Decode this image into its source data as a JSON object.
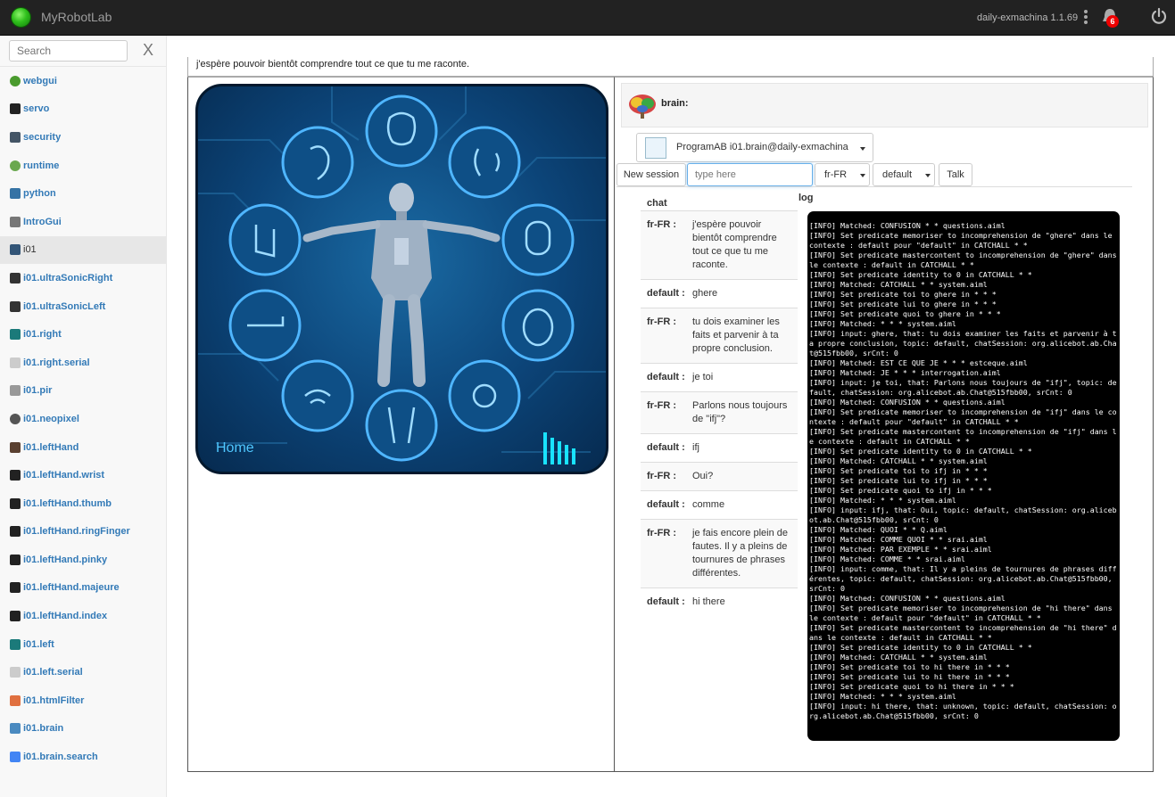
{
  "app": {
    "title": "MyRobotLab",
    "version": "daily-exmachina 1.1.69",
    "notification_count": "6"
  },
  "sidebar": {
    "search_placeholder": "Search",
    "clear_label": "X",
    "items": [
      {
        "label": "webgui",
        "icon": "globe-icon",
        "color": "#4a9b2e"
      },
      {
        "label": "servo",
        "icon": "servo-icon",
        "color": "#222222"
      },
      {
        "label": "security",
        "icon": "lock-icon",
        "color": "#445566"
      },
      {
        "label": "runtime",
        "icon": "runtime-icon",
        "color": "#6aa84f"
      },
      {
        "label": "python",
        "icon": "python-icon",
        "color": "#3673a5"
      },
      {
        "label": "IntroGui",
        "icon": "intro-icon",
        "color": "#777777"
      },
      {
        "label": "i01",
        "icon": "i01-icon",
        "color": "#335577",
        "active": true
      },
      {
        "label": "i01.ultraSonicRight",
        "icon": "ultrasonic-icon",
        "color": "#333333"
      },
      {
        "label": "i01.ultraSonicLeft",
        "icon": "ultrasonic-icon",
        "color": "#333333"
      },
      {
        "label": "i01.right",
        "icon": "arduino-icon",
        "color": "#1b7a7a"
      },
      {
        "label": "i01.right.serial",
        "icon": "serial-icon",
        "color": "#cccccc"
      },
      {
        "label": "i01.pir",
        "icon": "pir-icon",
        "color": "#999999"
      },
      {
        "label": "i01.neopixel",
        "icon": "neopixel-icon",
        "color": "#555555"
      },
      {
        "label": "i01.leftHand",
        "icon": "hand-icon",
        "color": "#5a4030"
      },
      {
        "label": "i01.leftHand.wrist",
        "icon": "servo-icon",
        "color": "#222222"
      },
      {
        "label": "i01.leftHand.thumb",
        "icon": "servo-icon",
        "color": "#222222"
      },
      {
        "label": "i01.leftHand.ringFinger",
        "icon": "servo-icon",
        "color": "#222222"
      },
      {
        "label": "i01.leftHand.pinky",
        "icon": "servo-icon",
        "color": "#222222"
      },
      {
        "label": "i01.leftHand.majeure",
        "icon": "servo-icon",
        "color": "#222222"
      },
      {
        "label": "i01.leftHand.index",
        "icon": "servo-icon",
        "color": "#222222"
      },
      {
        "label": "i01.left",
        "icon": "arduino-icon",
        "color": "#1b7a7a"
      },
      {
        "label": "i01.left.serial",
        "icon": "serial-icon",
        "color": "#cccccc"
      },
      {
        "label": "i01.htmlFilter",
        "icon": "html-icon",
        "color": "#e07040"
      },
      {
        "label": "i01.brain",
        "icon": "brain-icon",
        "color": "#4a8ac0"
      },
      {
        "label": "i01.brain.search",
        "icon": "google-icon",
        "color": "#4285f4"
      }
    ]
  },
  "main": {
    "top_message": "j'espère pouvoir bientôt comprendre tout ce que tu me raconte.",
    "robot_panel": {
      "home_label": "Home"
    },
    "brain": {
      "title": "brain:",
      "service_select": "ProgramAB  i01.brain@daily-exmachina",
      "new_session_label": "New session",
      "input_placeholder": "type here",
      "language_value": "fr-FR",
      "bot_value": "default",
      "talk_label": "Talk",
      "chat_title": "chat",
      "log_title": "log",
      "chat": [
        {
          "who": "fr-FR :",
          "msg": "j'espère pouvoir bientôt comprendre tout ce que tu me raconte."
        },
        {
          "who": "default :",
          "msg": "ghere"
        },
        {
          "who": "fr-FR :",
          "msg": "tu dois examiner les faits et parvenir à ta propre conclusion."
        },
        {
          "who": "default :",
          "msg": "je toi"
        },
        {
          "who": "fr-FR :",
          "msg": "Parlons nous toujours de \"ifj\"?"
        },
        {
          "who": "default :",
          "msg": "ifj"
        },
        {
          "who": "fr-FR :",
          "msg": "Oui?"
        },
        {
          "who": "default :",
          "msg": "comme"
        },
        {
          "who": "fr-FR :",
          "msg": "je fais encore plein de fautes. Il y a pleins de tournures de phrases différentes."
        },
        {
          "who": "default :",
          "msg": "hi there"
        }
      ],
      "log_lines": [
        "[INFO] Matched: CONFUSION * * questions.aiml",
        "[INFO] Set predicate memoriser to incomprehension de \"ghere\" dans le contexte : default pour \"default\" in CATCHALL * *",
        "[INFO] Set predicate mastercontent to incomprehension de \"ghere\" dans le contexte : default in CATCHALL * *",
        "[INFO] Set predicate identity to 0 in CATCHALL * *",
        "[INFO] Matched: CATCHALL * * system.aiml",
        "[INFO] Set predicate toi to ghere in * * *",
        "[INFO] Set predicate lui to ghere in * * *",
        "[INFO] Set predicate quoi to ghere in * * *",
        "[INFO] Matched: * * * system.aiml",
        "[INFO] input: ghere, that: tu dois examiner les faits et parvenir à ta propre conclusion, topic: default, chatSession: org.alicebot.ab.Chat@515fbb00, srCnt: 0",
        "[INFO] Matched: EST CE QUE JE * * * estceque.aiml",
        "[INFO] Matched: JE * * * interrogation.aiml",
        "[INFO] input: je toi, that: Parlons nous toujours de \"ifj\", topic: default, chatSession: org.alicebot.ab.Chat@515fbb00, srCnt: 0",
        "[INFO] Matched: CONFUSION * * questions.aiml",
        "[INFO] Set predicate memoriser to incomprehension de \"ifj\" dans le contexte : default pour \"default\" in CATCHALL * *",
        "[INFO] Set predicate mastercontent to incomprehension de \"ifj\" dans le contexte : default in CATCHALL * *",
        "[INFO] Set predicate identity to 0 in CATCHALL * *",
        "[INFO] Matched: CATCHALL * * system.aiml",
        "[INFO] Set predicate toi to ifj in * * *",
        "[INFO] Set predicate lui to ifj in * * *",
        "[INFO] Set predicate quoi to ifj in * * *",
        "[INFO] Matched: * * * system.aiml",
        "[INFO] input: ifj, that: Oui, topic: default, chatSession: org.alicebot.ab.Chat@515fbb00, srCnt: 0",
        "[INFO] Matched: QUOI * * Q.aiml",
        "[INFO] Matched: COMME QUOI * * srai.aiml",
        "[INFO] Matched: PAR EXEMPLE * * srai.aiml",
        "[INFO] Matched: COMME * * srai.aiml",
        "[INFO] input: comme, that: Il y a pleins de tournures de phrases différentes, topic: default, chatSession: org.alicebot.ab.Chat@515fbb00, srCnt: 0",
        "[INFO] Matched: CONFUSION * * questions.aiml",
        "[INFO] Set predicate memoriser to incomprehension de \"hi there\" dans le contexte : default pour \"default\" in CATCHALL * *",
        "[INFO] Set predicate mastercontent to incomprehension de \"hi there\" dans le contexte : default in CATCHALL * *",
        "[INFO] Set predicate identity to 0 in CATCHALL * *",
        "[INFO] Matched: CATCHALL * * system.aiml",
        "[INFO] Set predicate toi to hi there in * * *",
        "[INFO] Set predicate lui to hi there in * * *",
        "[INFO] Set predicate quoi to hi there in * * *",
        "[INFO] Matched: * * * system.aiml",
        "[INFO] input: hi there, that: unknown, topic: default, chatSession: org.alicebot.ab.Chat@515fbb00, srCnt: 0"
      ]
    }
  }
}
